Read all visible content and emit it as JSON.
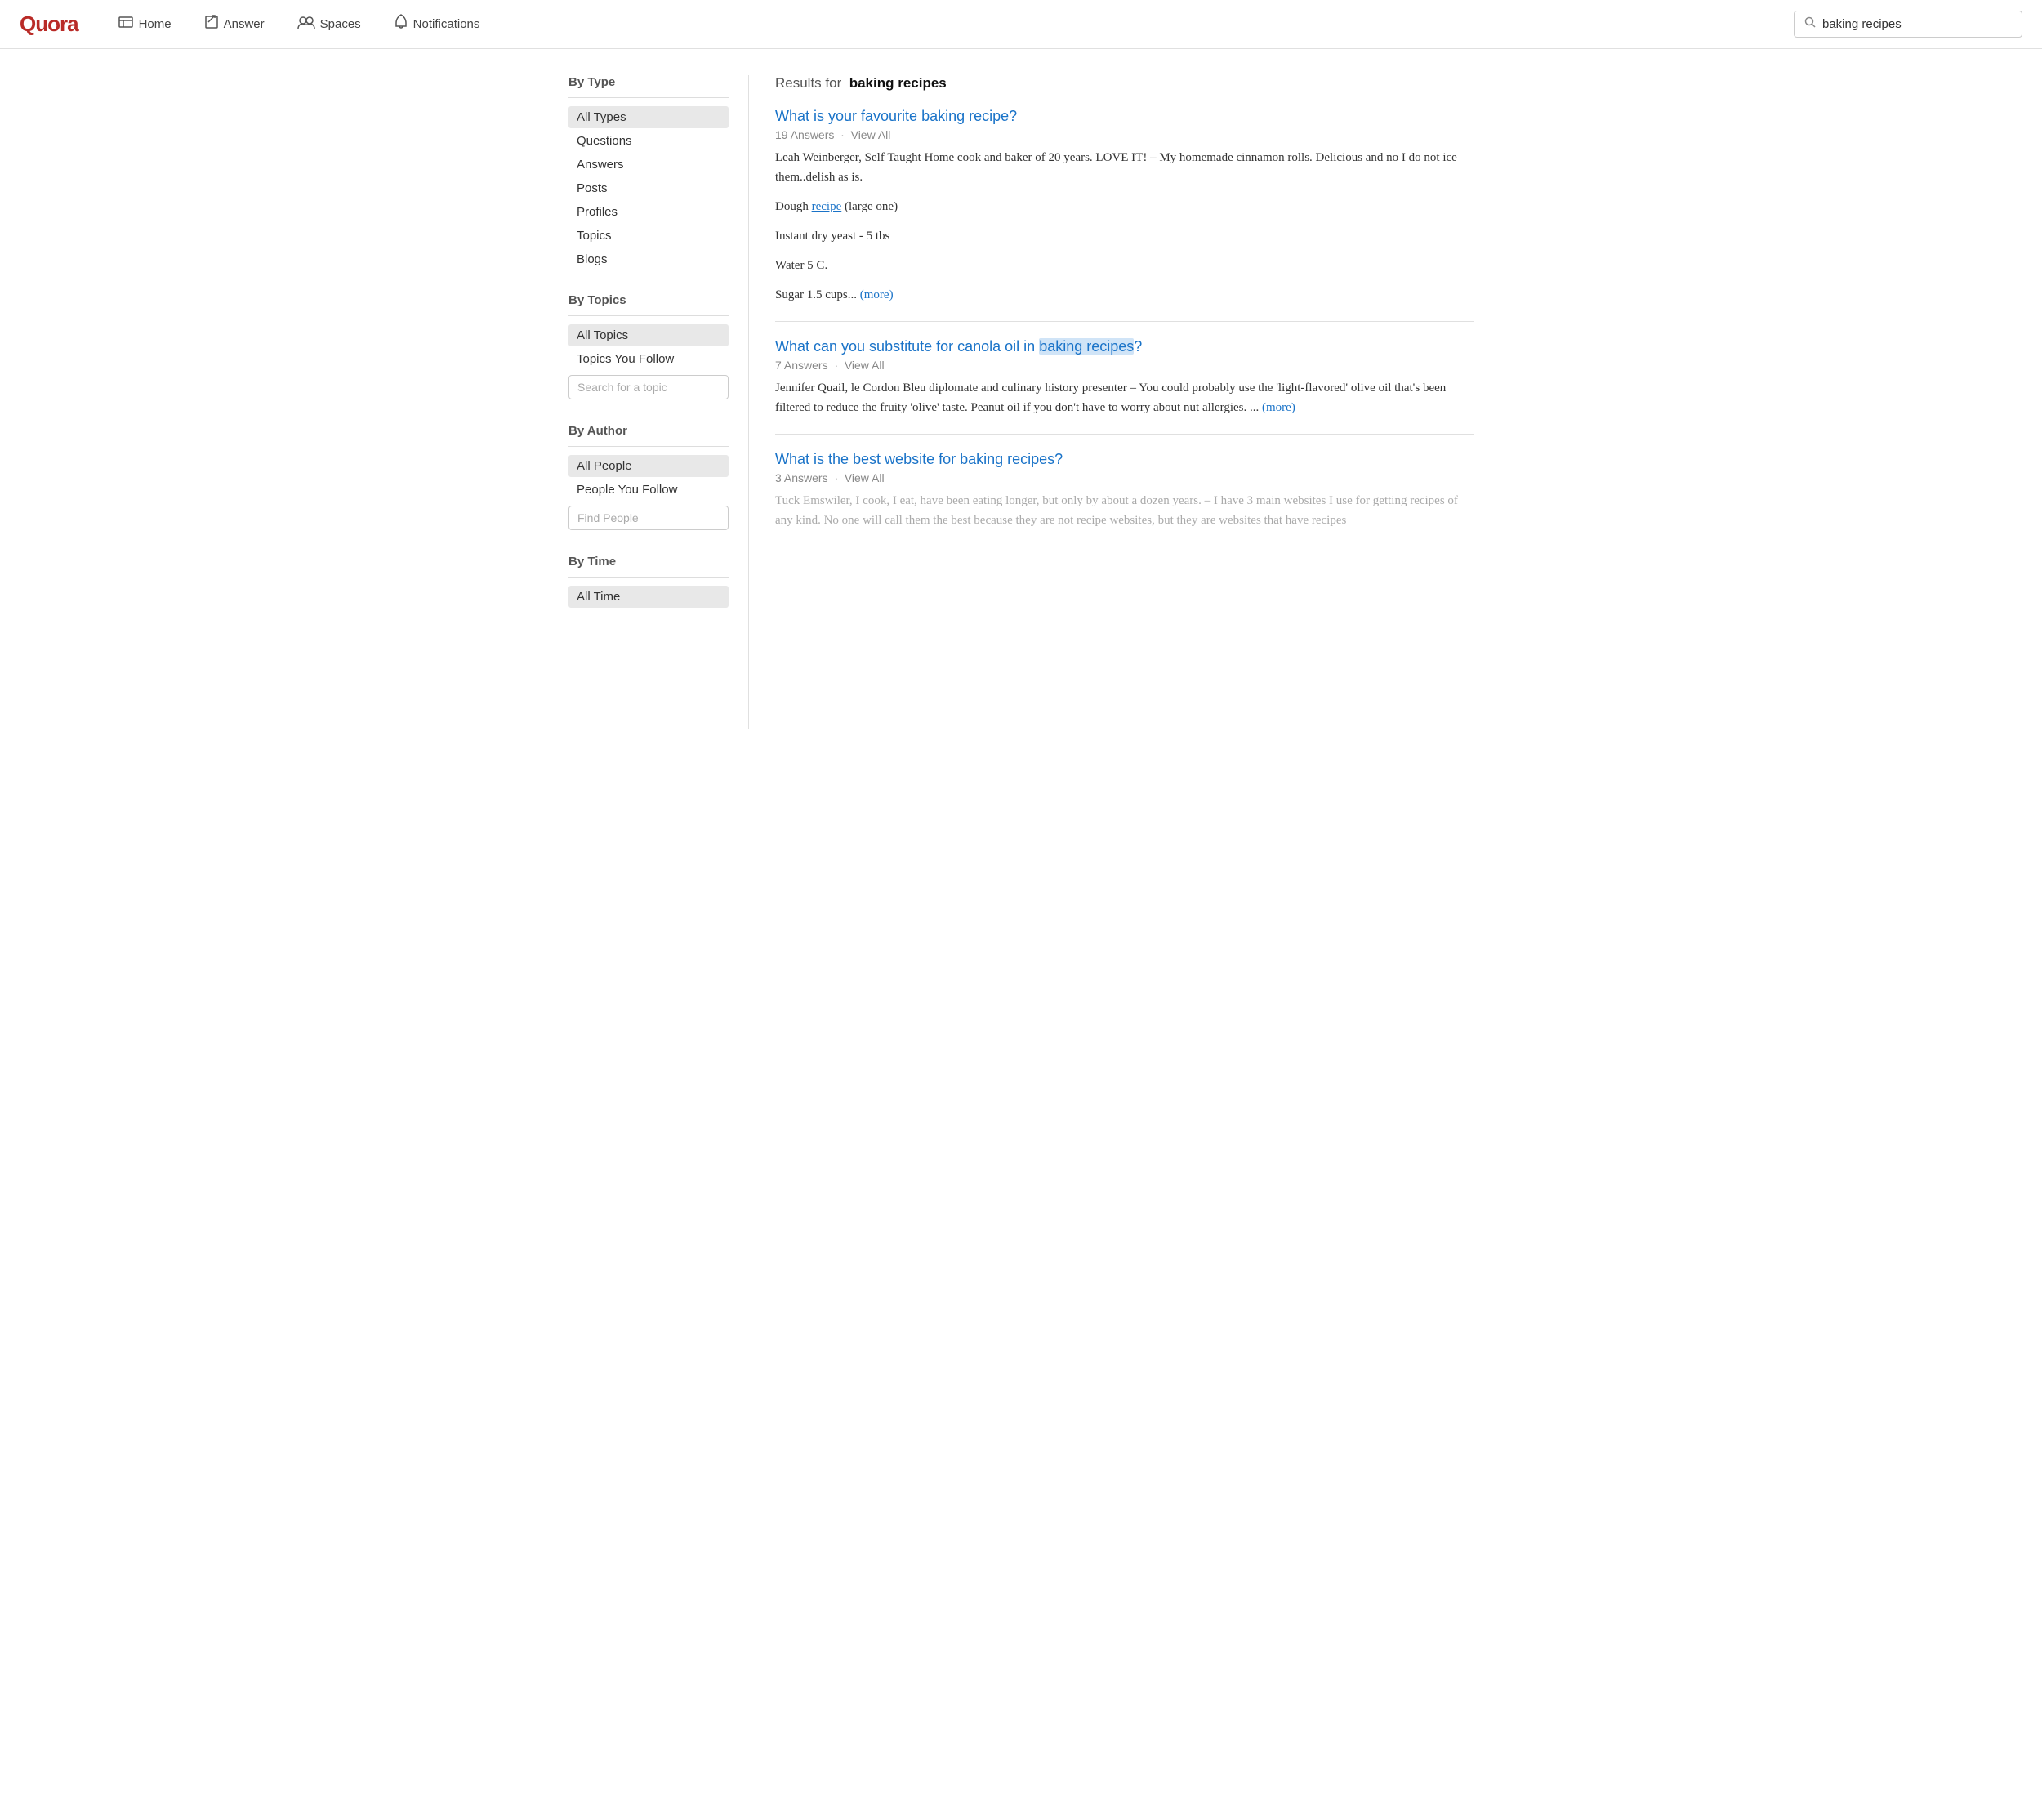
{
  "logo": "Quora",
  "navbar": {
    "items": [
      {
        "id": "home",
        "label": "Home",
        "icon": "🗒"
      },
      {
        "id": "answer",
        "label": "Answer",
        "icon": "✏️"
      },
      {
        "id": "spaces",
        "label": "Spaces",
        "icon": "👥"
      },
      {
        "id": "notifications",
        "label": "Notifications",
        "icon": "🔔"
      }
    ],
    "search": {
      "value": "baking recipes",
      "placeholder": "Search Quora"
    }
  },
  "sidebar": {
    "by_type": {
      "title": "By Type",
      "items": [
        {
          "id": "all-types",
          "label": "All Types",
          "active": true
        },
        {
          "id": "questions",
          "label": "Questions",
          "active": false
        },
        {
          "id": "answers",
          "label": "Answers",
          "active": false
        },
        {
          "id": "posts",
          "label": "Posts",
          "active": false
        },
        {
          "id": "profiles",
          "label": "Profiles",
          "active": false
        },
        {
          "id": "topics",
          "label": "Topics",
          "active": false
        },
        {
          "id": "blogs",
          "label": "Blogs",
          "active": false
        }
      ]
    },
    "by_topics": {
      "title": "By Topics",
      "items": [
        {
          "id": "all-topics",
          "label": "All Topics",
          "active": true
        },
        {
          "id": "topics-you-follow",
          "label": "Topics You Follow",
          "active": false
        }
      ],
      "search_placeholder": "Search for a topic"
    },
    "by_author": {
      "title": "By Author",
      "items": [
        {
          "id": "all-people",
          "label": "All People",
          "active": true
        },
        {
          "id": "people-you-follow",
          "label": "People You Follow",
          "active": false
        }
      ],
      "search_placeholder": "Find People"
    },
    "by_time": {
      "title": "By Time",
      "items": [
        {
          "id": "all-time",
          "label": "All Time",
          "active": true
        }
      ]
    }
  },
  "results": {
    "query": "baking recipes",
    "results_label": "Results for",
    "items": [
      {
        "id": "result-1",
        "title": "What is your favourite baking recipe?",
        "answers": "19 Answers",
        "view_all": "View All",
        "body_paragraphs": [
          "Leah Weinberger, Self Taught Home cook and baker of 20 years. LOVE IT! – My homemade cinnamon rolls. Delicious and no I do not ice them..delish as is.",
          "Dough recipe (large one)",
          "Instant dry yeast - 5 tbs",
          "Water 5 C.",
          "Sugar 1.5 cups..."
        ],
        "more_label": "(more)",
        "highlight_words": []
      },
      {
        "id": "result-2",
        "title": "What can you substitute for canola oil in baking recipes?",
        "title_highlight": "baking recipes",
        "answers": "7 Answers",
        "view_all": "View All",
        "body": "Jennifer Quail, le Cordon Bleu diplomate and culinary history presenter – You could probably use the 'light-flavored' olive oil that's been filtered to reduce the fruity 'olive' taste.  Peanut oil if you don't have to worry about nut allergies. ...",
        "more_label": "(more)"
      },
      {
        "id": "result-3",
        "title": "What is the best website for baking recipes?",
        "answers": "3 Answers",
        "view_all": "View All",
        "body": "Tuck Emswiler, I cook, I eat, have been eating longer, but only by about a dozen years. – I have 3 main websites I use for getting recipes of any kind. No one will call them the best because they are not recipe websites, but they are websites that have recipes",
        "faded": true
      }
    ]
  }
}
